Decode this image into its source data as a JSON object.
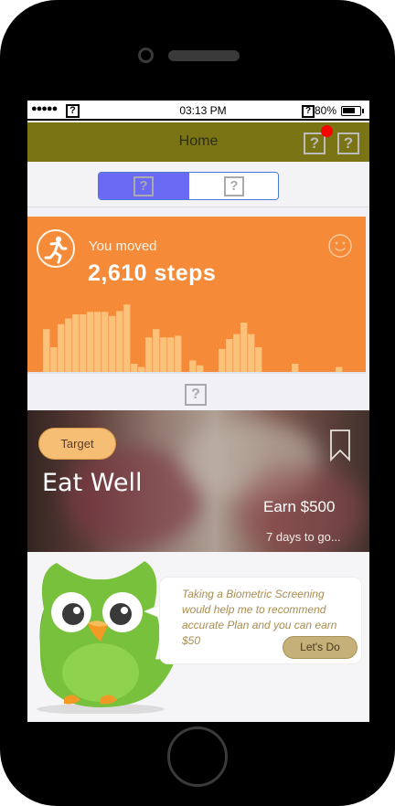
{
  "status_bar": {
    "signal": "●●●●●",
    "icon_placeholder": "?",
    "time": "03:13 PM",
    "battery_percent": "80%",
    "battery_level": 0.8
  },
  "header": {
    "title": "Home",
    "icon1": "?",
    "icon2": "?",
    "has_notification": true
  },
  "segment": {
    "left_icon": "?",
    "right_icon": "?",
    "selected": "left",
    "selected_color": "#6a6af5"
  },
  "steps_card": {
    "label": "You moved",
    "value": "2,610 steps",
    "accent": "#f58a38",
    "icons": [
      "runner-icon",
      "smiley-icon"
    ]
  },
  "chart_data": {
    "type": "bar",
    "values": [
      52,
      30,
      58,
      65,
      70,
      70,
      73,
      73,
      73,
      68,
      74,
      82,
      10,
      6,
      42,
      52,
      42,
      42,
      44,
      0,
      14,
      8,
      0,
      0,
      28,
      40,
      46,
      60,
      46,
      30,
      0,
      0,
      0,
      0,
      10,
      0,
      0,
      0,
      0,
      0,
      6
    ],
    "bar_color": "#fbc27c",
    "grid": false
  },
  "mid_icon": "?",
  "food_card": {
    "target_label": "Target",
    "title": "Eat Well",
    "earn": "Earn $500",
    "days": "7 days to go...",
    "icons": [
      "bookmark-icon"
    ]
  },
  "owl_bubble": {
    "text": "Taking a Biometric Screening would help me to recommend accurate Plan and you can earn $50",
    "button": "Let's Do"
  }
}
